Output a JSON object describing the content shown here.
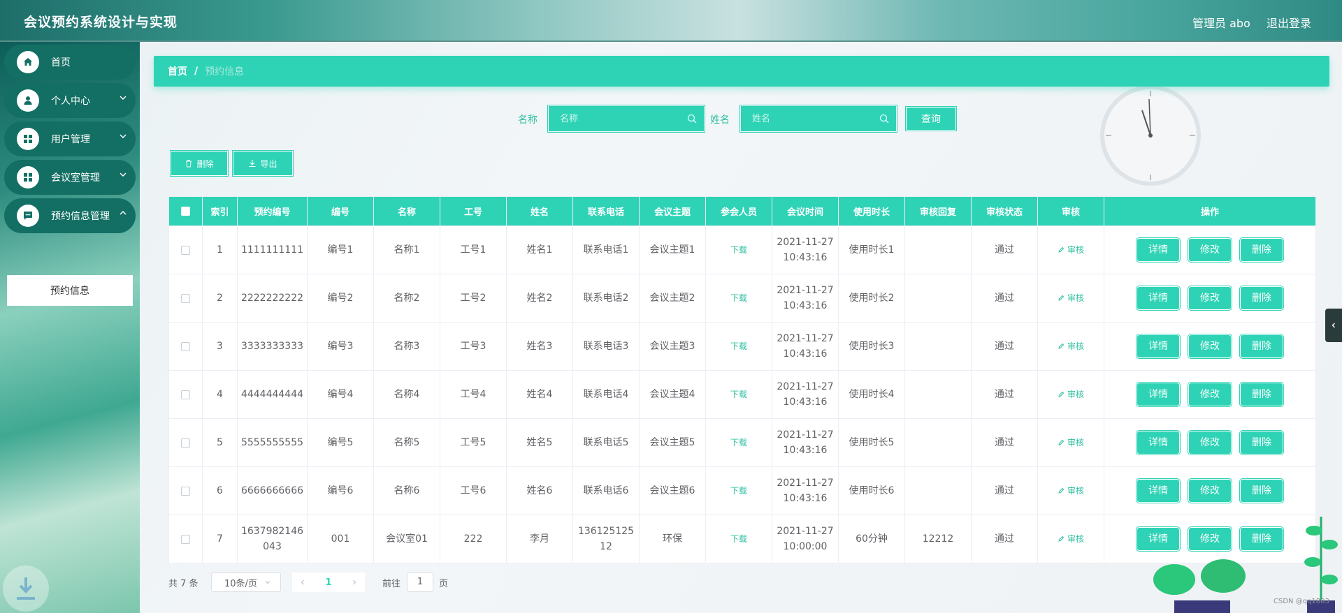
{
  "header": {
    "title": "会议预约系统设计与实现",
    "user": "管理员 abo",
    "logout": "退出登录"
  },
  "sidebar": {
    "items": [
      {
        "label": "首页",
        "icon": "home-icon"
      },
      {
        "label": "个人中心",
        "icon": "user-icon"
      },
      {
        "label": "用户管理",
        "icon": "grid-icon"
      },
      {
        "label": "会议室管理",
        "icon": "grid-icon"
      },
      {
        "label": "预约信息管理",
        "icon": "chat-icon"
      }
    ],
    "submenu_label": "预约信息"
  },
  "breadcrumb": {
    "home": "首页",
    "separator": "/",
    "current": "预约信息"
  },
  "search": {
    "name_label": "名称",
    "name_placeholder": "名称",
    "person_label": "姓名",
    "person_placeholder": "姓名",
    "query_label": "查询"
  },
  "toolbar": {
    "delete_label": "删除",
    "export_label": "导出"
  },
  "table": {
    "columns": [
      "索引",
      "预约编号",
      "编号",
      "名称",
      "工号",
      "姓名",
      "联系电话",
      "会议主题",
      "参会人员",
      "会议时间",
      "使用时长",
      "审核回复",
      "审核状态",
      "审核",
      "操作"
    ],
    "rows": [
      {
        "index": "1",
        "booking_no": "1111111111",
        "code": "编号1",
        "name": "名称1",
        "emp_no": "工号1",
        "person": "姓名1",
        "phone": "联系电话1",
        "topic": "会议主题1",
        "attendees": "下载",
        "time": "2021-11-27 10:43:16",
        "duration": "使用时长1",
        "reply": "",
        "status": "通过",
        "audit": "审核"
      },
      {
        "index": "2",
        "booking_no": "2222222222",
        "code": "编号2",
        "name": "名称2",
        "emp_no": "工号2",
        "person": "姓名2",
        "phone": "联系电话2",
        "topic": "会议主题2",
        "attendees": "下载",
        "time": "2021-11-27 10:43:16",
        "duration": "使用时长2",
        "reply": "",
        "status": "通过",
        "audit": "审核"
      },
      {
        "index": "3",
        "booking_no": "3333333333",
        "code": "编号3",
        "name": "名称3",
        "emp_no": "工号3",
        "person": "姓名3",
        "phone": "联系电话3",
        "topic": "会议主题3",
        "attendees": "下载",
        "time": "2021-11-27 10:43:16",
        "duration": "使用时长3",
        "reply": "",
        "status": "通过",
        "audit": "审核"
      },
      {
        "index": "4",
        "booking_no": "4444444444",
        "code": "编号4",
        "name": "名称4",
        "emp_no": "工号4",
        "person": "姓名4",
        "phone": "联系电话4",
        "topic": "会议主题4",
        "attendees": "下载",
        "time": "2021-11-27 10:43:16",
        "duration": "使用时长4",
        "reply": "",
        "status": "通过",
        "audit": "审核"
      },
      {
        "index": "5",
        "booking_no": "5555555555",
        "code": "编号5",
        "name": "名称5",
        "emp_no": "工号5",
        "person": "姓名5",
        "phone": "联系电话5",
        "topic": "会议主题5",
        "attendees": "下载",
        "time": "2021-11-27 10:43:16",
        "duration": "使用时长5",
        "reply": "",
        "status": "通过",
        "audit": "审核"
      },
      {
        "index": "6",
        "booking_no": "6666666666",
        "code": "编号6",
        "name": "名称6",
        "emp_no": "工号6",
        "person": "姓名6",
        "phone": "联系电话6",
        "topic": "会议主题6",
        "attendees": "下载",
        "time": "2021-11-27 10:43:16",
        "duration": "使用时长6",
        "reply": "",
        "status": "通过",
        "audit": "审核"
      },
      {
        "index": "7",
        "booking_no": "1637982146043",
        "code": "001",
        "name": "会议室01",
        "emp_no": "222",
        "person": "李月",
        "phone": "13612512512",
        "topic": "环保",
        "attendees": "下载",
        "time": "2021-11-27 10:00:00",
        "duration": "60分钟",
        "reply": "12212",
        "status": "通过",
        "audit": "审核"
      }
    ],
    "actions": {
      "detail": "详情",
      "edit": "修改",
      "delete": "删除"
    }
  },
  "pagination": {
    "total": "共 7 条",
    "page_size": "10条/页",
    "current_page": "1",
    "goto_prefix": "前往",
    "goto_value": "1",
    "goto_suffix": "页"
  },
  "watermark": "CSDN @qq1803",
  "colors": {
    "accent": "#2ed3b6",
    "nav_bg": "#136f63",
    "header_bg": "#3a9a8f"
  }
}
